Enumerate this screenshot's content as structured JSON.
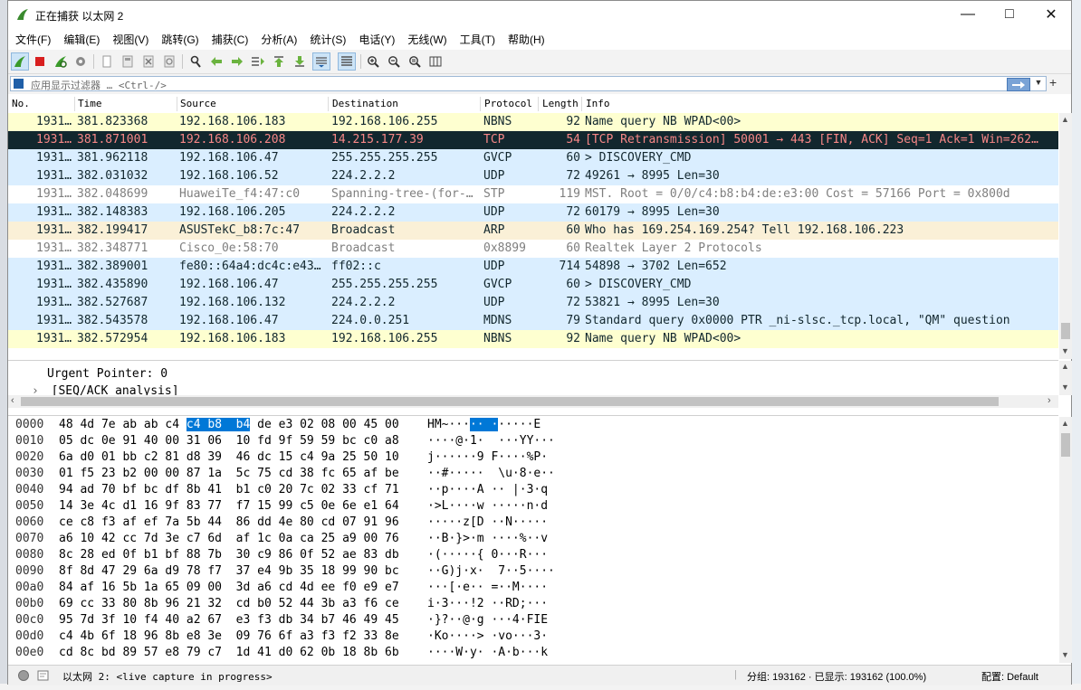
{
  "window": {
    "title": "正在捕获 以太网 2"
  },
  "menu": [
    "文件(F)",
    "编辑(E)",
    "视图(V)",
    "跳转(G)",
    "捕获(C)",
    "分析(A)",
    "统计(S)",
    "电话(Y)",
    "无线(W)",
    "工具(T)",
    "帮助(H)"
  ],
  "filter": {
    "placeholder": "应用显示过滤器 … <Ctrl-/>"
  },
  "columns": [
    "No.",
    "Time",
    "Source",
    "Destination",
    "Protocol",
    "Length",
    "Info"
  ],
  "packets": [
    {
      "no": "1931…",
      "time": "381.823368",
      "src": "192.168.106.183",
      "dst": "192.168.106.255",
      "proto": "NBNS",
      "len": "92",
      "info": "Name query NB WPAD<00>",
      "bg": "#feffd0",
      "fg": "#12272e"
    },
    {
      "no": "1931…",
      "time": "381.871001",
      "src": "192.168.106.208",
      "dst": "14.215.177.39",
      "proto": "TCP",
      "len": "54",
      "info": "[TCP Retransmission] 50001 → 443 [FIN, ACK] Seq=1 Ack=1 Win=262…",
      "bg": "#12272e",
      "fg": "#f78787"
    },
    {
      "no": "1931…",
      "time": "381.962118",
      "src": "192.168.106.47",
      "dst": "255.255.255.255",
      "proto": "GVCP",
      "len": "60",
      "info": "> DISCOVERY_CMD",
      "bg": "#daeeff",
      "fg": "#12272e"
    },
    {
      "no": "1931…",
      "time": "382.031032",
      "src": "192.168.106.52",
      "dst": "224.2.2.2",
      "proto": "UDP",
      "len": "72",
      "info": "49261 → 8995 Len=30",
      "bg": "#daeeff",
      "fg": "#12272e"
    },
    {
      "no": "1931…",
      "time": "382.048699",
      "src": "HuaweiTe_f4:47:c0",
      "dst": "Spanning-tree-(for-…",
      "proto": "STP",
      "len": "119",
      "info": "MST. Root = 0/0/c4:b8:b4:de:e3:00  Cost = 57166  Port = 0x800d",
      "bg": "#ffffff",
      "fg": "#7f7f7f"
    },
    {
      "no": "1931…",
      "time": "382.148383",
      "src": "192.168.106.205",
      "dst": "224.2.2.2",
      "proto": "UDP",
      "len": "72",
      "info": "60179 → 8995 Len=30",
      "bg": "#daeeff",
      "fg": "#12272e"
    },
    {
      "no": "1931…",
      "time": "382.199417",
      "src": "ASUSTekC_b8:7c:47",
      "dst": "Broadcast",
      "proto": "ARP",
      "len": "60",
      "info": "Who has 169.254.169.254? Tell 192.168.106.223",
      "bg": "#faf0d7",
      "fg": "#12272e"
    },
    {
      "no": "1931…",
      "time": "382.348771",
      "src": "Cisco_0e:58:70",
      "dst": "Broadcast",
      "proto": "0x8899",
      "len": "60",
      "info": "Realtek Layer 2 Protocols",
      "bg": "#ffffff",
      "fg": "#7f7f7f"
    },
    {
      "no": "1931…",
      "time": "382.389001",
      "src": "fe80::64a4:dc4c:e43…",
      "dst": "ff02::c",
      "proto": "UDP",
      "len": "714",
      "info": "54898 → 3702 Len=652",
      "bg": "#daeeff",
      "fg": "#12272e"
    },
    {
      "no": "1931…",
      "time": "382.435890",
      "src": "192.168.106.47",
      "dst": "255.255.255.255",
      "proto": "GVCP",
      "len": "60",
      "info": "> DISCOVERY_CMD",
      "bg": "#daeeff",
      "fg": "#12272e"
    },
    {
      "no": "1931…",
      "time": "382.527687",
      "src": "192.168.106.132",
      "dst": "224.2.2.2",
      "proto": "UDP",
      "len": "72",
      "info": "53821 → 8995 Len=30",
      "bg": "#daeeff",
      "fg": "#12272e"
    },
    {
      "no": "1931…",
      "time": "382.543578",
      "src": "192.168.106.47",
      "dst": "224.0.0.251",
      "proto": "MDNS",
      "len": "79",
      "info": "Standard query 0x0000 PTR _ni-slsc._tcp.local, \"QM\" question",
      "bg": "#daeeff",
      "fg": "#12272e"
    },
    {
      "no": "1931…",
      "time": "382.572954",
      "src": "192.168.106.183",
      "dst": "192.168.106.255",
      "proto": "NBNS",
      "len": "92",
      "info": "Name query NB WPAD<00>",
      "bg": "#feffd0",
      "fg": "#12272e"
    }
  ],
  "details": [
    "Urgent Pointer: 0",
    "[SEQ/ACK analysis]"
  ],
  "bytes": [
    {
      "off": "0000",
      "pre": "48 4d 7e ab ab c4 ",
      "hl": "c4 b8  b4",
      "post": " de e3 02 08 00 45 00",
      "apre": "HM~···",
      "ahl": "·· ·",
      "apost": "·····E"
    },
    {
      "off": "0010",
      "hex": "05 dc 0e 91 40 00 31 06  10 fd 9f 59 59 bc c0 a8",
      "ascii": "····@·1·  ···YY···"
    },
    {
      "off": "0020",
      "hex": "6a d0 01 bb c2 81 d8 39  46 dc 15 c4 9a 25 50 10",
      "ascii": "j······9 F····%P·"
    },
    {
      "off": "0030",
      "hex": "01 f5 23 b2 00 00 87 1a  5c 75 cd 38 fc 65 af be",
      "ascii": "··#·····  \\u·8·e··"
    },
    {
      "off": "0040",
      "hex": "94 ad 70 bf bc df 8b 41  b1 c0 20 7c 02 33 cf 71",
      "ascii": "··p····A ·· |·3·q"
    },
    {
      "off": "0050",
      "hex": "14 3e 4c d1 16 9f 83 77  f7 15 99 c5 0e 6e e1 64",
      "ascii": "·>L····w ·····n·d"
    },
    {
      "off": "0060",
      "hex": "ce c8 f3 af ef 7a 5b 44  86 dd 4e 80 cd 07 91 96",
      "ascii": "·····z[D ··N·····"
    },
    {
      "off": "0070",
      "hex": "a6 10 42 cc 7d 3e c7 6d  af 1c 0a ca 25 a9 00 76",
      "ascii": "··B·}>·m ····%··v"
    },
    {
      "off": "0080",
      "hex": "8c 28 ed 0f b1 bf 88 7b  30 c9 86 0f 52 ae 83 db",
      "ascii": "·(·····{ 0···R···"
    },
    {
      "off": "0090",
      "hex": "8f 8d 47 29 6a d9 78 f7  37 e4 9b 35 18 99 90 bc",
      "ascii": "··G)j·x·  7··5····"
    },
    {
      "off": "00a0",
      "hex": "84 af 16 5b 1a 65 09 00  3d a6 cd 4d ee f0 e9 e7",
      "ascii": "···[·e·· =··M····"
    },
    {
      "off": "00b0",
      "hex": "69 cc 33 80 8b 96 21 32  cd b0 52 44 3b a3 f6 ce",
      "ascii": "i·3···!2 ··RD;···"
    },
    {
      "off": "00c0",
      "hex": "95 7d 3f 10 f4 40 a2 67  e3 f3 db 34 b7 46 49 45",
      "ascii": "·}?··@·g ···4·FIE"
    },
    {
      "off": "00d0",
      "hex": "c4 4b 6f 18 96 8b e8 3e  09 76 6f a3 f3 f2 33 8e",
      "ascii": "·Ko····> ·vo···3·"
    },
    {
      "off": "00e0",
      "hex": "cd 8c bd 89 57 e8 79 c7  1d 41 d0 62 0b 18 8b 6b",
      "ascii": "····W·y· ·A·b···k"
    }
  ],
  "status": {
    "interface": "以太网 2: <live capture in progress>",
    "packets": "分组: 193162 · 已显示: 193162 (100.0%)",
    "profile": "配置: Default"
  }
}
